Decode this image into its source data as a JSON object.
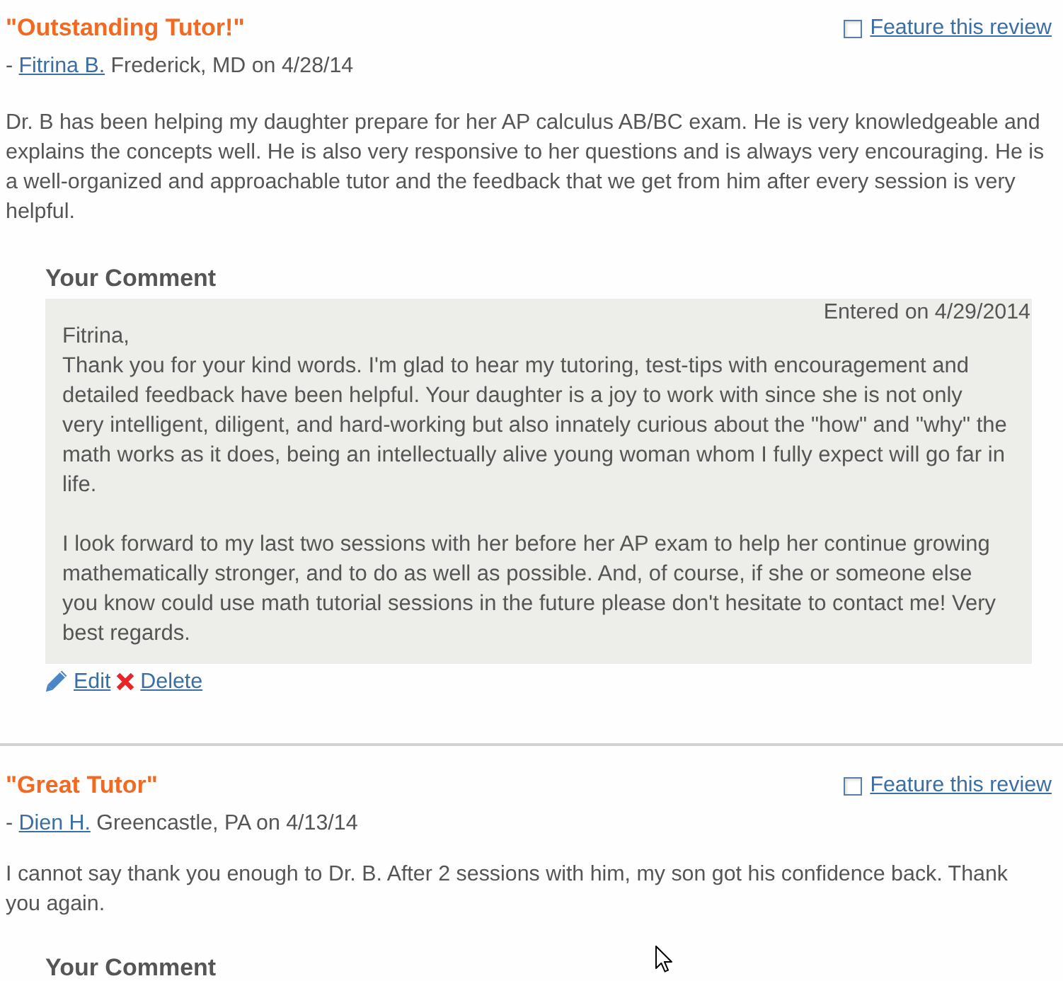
{
  "reviews": [
    {
      "title": "\"Outstanding Tutor!\"",
      "feature": {
        "label": "Feature this review",
        "checked": false
      },
      "byline": {
        "prefix": "-",
        "author": "Fitrina B.",
        "location": "Frederick, MD on 4/28/14"
      },
      "text": "Dr. B has been helping my daughter prepare for her AP calculus AB/BC exam. He is very knowledgeable and explains the concepts well. He is also very responsive to her questions and is always very encouraging. He is a well-organized and approachable tutor and the feedback that we get from him after every session is very helpful.",
      "comment": {
        "heading": "Your Comment",
        "entered": "Entered on 4/29/2014",
        "body": "Fitrina,\nThank you for your kind words. I'm glad to hear my tutoring, test-tips with encouragement and detailed feedback have been helpful. Your daughter is a joy to work with since she is not only very intelligent, diligent, and hard-working but also innately curious about the \"how\" and \"why\" the math works as it does, being an intellectually alive young woman whom I fully expect will go far in life.\n\nI look forward to my last two sessions with her before her AP exam to help her continue growing mathematically stronger, and to do as well as possible. And, of course, if she or someone else you know could use math tutorial sessions in the future please don't hesitate to contact me! Very best regards.",
        "actions": [
          {
            "kind": "edit",
            "label": "Edit"
          },
          {
            "kind": "delete",
            "label": "Delete"
          }
        ]
      }
    },
    {
      "title": "\"Great Tutor\"",
      "feature": {
        "label": "Feature this review",
        "checked": false
      },
      "byline": {
        "prefix": "-",
        "author": "Dien H.",
        "location": "Greencastle, PA on 4/13/14"
      },
      "text": "I cannot say thank you enough to Dr. B. After 2 sessions with him, my son got his confidence back. Thank you again.",
      "comment": {
        "heading": "Your Comment"
      }
    }
  ]
}
